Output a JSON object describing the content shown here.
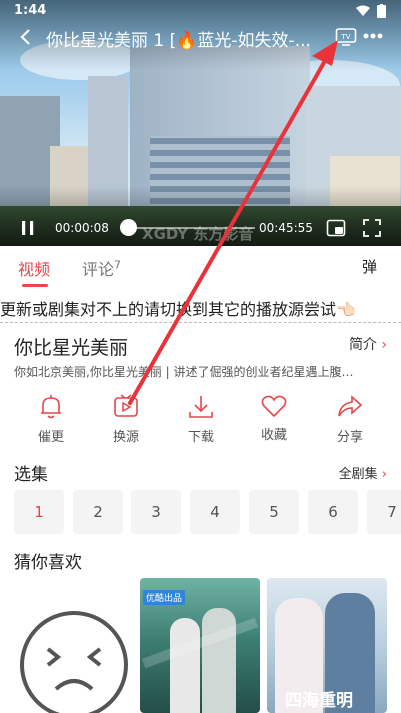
{
  "status_bar": {
    "time": "1:44"
  },
  "player": {
    "title": "你比星光美丽 1 [🔥蓝光-如失效-...",
    "current_time": "00:00:08",
    "total_time": "00:45:55",
    "progress": 0.003,
    "watermark": "XGDY 东方影音"
  },
  "tabs": {
    "video_label": "视频",
    "comments_label": "评论",
    "comments_count": "7",
    "danmaku_label": "弹"
  },
  "notice": "更新或剧集对不上的请切换到其它的播放源尝试👈🏻",
  "show": {
    "title": "你比星光美丽",
    "intro_label": "简介",
    "description": "你如北京美丽,你比星光美丽 | 讲述了倔强的创业者纪星遇上腹…"
  },
  "actions": [
    {
      "label": "催更",
      "icon": "bell-icon"
    },
    {
      "label": "换源",
      "icon": "play-source-icon"
    },
    {
      "label": "下载",
      "icon": "download-icon"
    },
    {
      "label": "收藏",
      "icon": "heart-icon"
    },
    {
      "label": "分享",
      "icon": "share-icon"
    }
  ],
  "episodes": {
    "header": "选集",
    "all_label": "全剧集",
    "list": [
      "1",
      "2",
      "3",
      "4",
      "5",
      "6",
      "7"
    ],
    "active_index": 0
  },
  "recommend": {
    "header": "猜你喜欢",
    "poster2_badge": "优酷出品",
    "poster3_caption": "四海重明"
  },
  "colors": {
    "accent": "#e5474b",
    "annotation": "#e8333a"
  }
}
